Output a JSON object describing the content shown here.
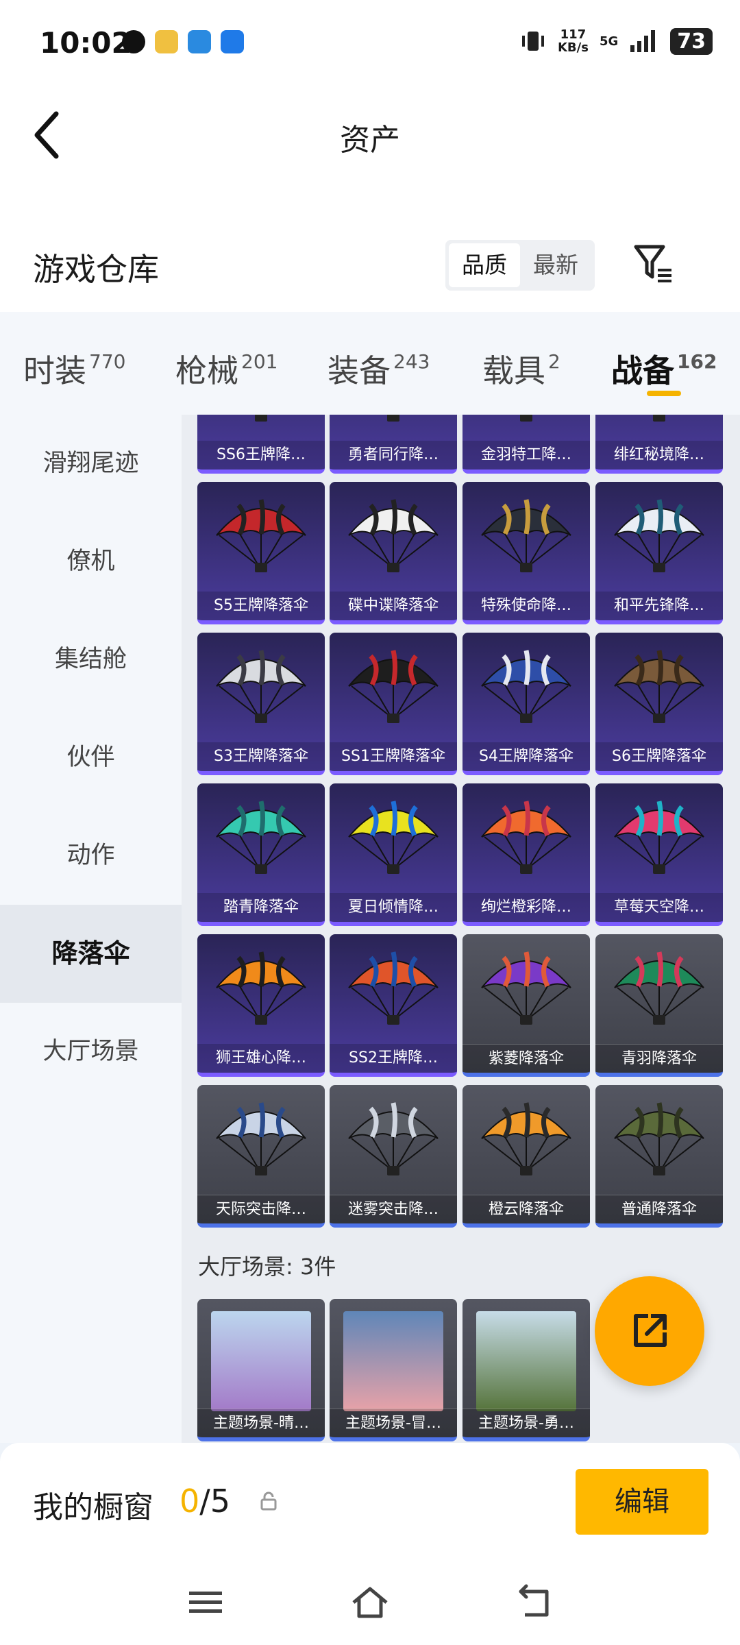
{
  "status_bar": {
    "time": "10:02",
    "net_speed_value": "117",
    "net_speed_unit": "KB/s",
    "network": "5G",
    "battery": "73"
  },
  "header": {
    "title": "资产"
  },
  "section": {
    "title": "游戏仓库",
    "sort_options": [
      "品质",
      "最新"
    ],
    "selected_sort": "品质"
  },
  "tabs": [
    {
      "label": "时装",
      "count": "770"
    },
    {
      "label": "枪械",
      "count": "201"
    },
    {
      "label": "装备",
      "count": "243"
    },
    {
      "label": "载具",
      "count": "2"
    },
    {
      "label": "战备",
      "count": "162"
    }
  ],
  "active_tab": "战备",
  "sidebar": {
    "items": [
      "滑翔尾迹",
      "僚机",
      "集结舱",
      "伙伴",
      "动作",
      "降落伞",
      "大厅场景"
    ],
    "active": "降落伞"
  },
  "parachutes": [
    {
      "name": "SS6王牌降…",
      "tier": "purple",
      "colors": [
        "#3a2f26",
        "#8a6a4a"
      ]
    },
    {
      "name": "勇者同行降…",
      "tier": "purple",
      "colors": [
        "#2b2b2b",
        "#6d6d6d"
      ]
    },
    {
      "name": "金羽特工降…",
      "tier": "purple",
      "colors": [
        "#4a3b22",
        "#c79a44"
      ]
    },
    {
      "name": "绯红秘境降…",
      "tier": "purple",
      "colors": [
        "#5a2b39",
        "#c06a7a"
      ]
    },
    {
      "name": "S5王牌降落伞",
      "tier": "purple",
      "colors": [
        "#c4272b",
        "#222222"
      ]
    },
    {
      "name": "碟中谍降落伞",
      "tier": "purple",
      "colors": [
        "#f0f0f0",
        "#222222"
      ]
    },
    {
      "name": "特殊使命降…",
      "tier": "purple",
      "colors": [
        "#2a2f3a",
        "#c89d3e"
      ]
    },
    {
      "name": "和平先锋降…",
      "tier": "purple",
      "colors": [
        "#e9eef5",
        "#1f5d77"
      ]
    },
    {
      "name": "S3王牌降落伞",
      "tier": "purple",
      "colors": [
        "#d9dbe0",
        "#3b3b45"
      ]
    },
    {
      "name": "SS1王牌降落伞",
      "tier": "purple",
      "colors": [
        "#1e1e1e",
        "#c6282c"
      ]
    },
    {
      "name": "S4王牌降落伞",
      "tier": "purple",
      "colors": [
        "#2e4ea8",
        "#e6e8f0"
      ]
    },
    {
      "name": "S6王牌降落伞",
      "tier": "purple",
      "colors": [
        "#7a5a3a",
        "#3a2a1a"
      ]
    },
    {
      "name": "踏青降落伞",
      "tier": "purple",
      "colors": [
        "#35c9b0",
        "#1f6d6d"
      ]
    },
    {
      "name": "夏日倾情降…",
      "tier": "purple",
      "colors": [
        "#e8e21f",
        "#1e6fd8"
      ]
    },
    {
      "name": "绚烂橙彩降…",
      "tier": "purple",
      "colors": [
        "#f06a2e",
        "#c8364a"
      ]
    },
    {
      "name": "草莓天空降…",
      "tier": "purple",
      "colors": [
        "#e23a6e",
        "#1fb3c8"
      ]
    },
    {
      "name": "狮王雄心降…",
      "tier": "purple",
      "colors": [
        "#f08a1a",
        "#1e1e1e"
      ]
    },
    {
      "name": "SS2王牌降…",
      "tier": "purple",
      "colors": [
        "#e0552a",
        "#1e4fa8"
      ]
    },
    {
      "name": "紫菱降落伞",
      "tier": "gray",
      "colors": [
        "#7a3ac8",
        "#e05a3a"
      ]
    },
    {
      "name": "青羽降落伞",
      "tier": "gray",
      "colors": [
        "#1e8a5a",
        "#d43a5a"
      ]
    },
    {
      "name": "天际突击降…",
      "tier": "gray",
      "colors": [
        "#c9d4e6",
        "#2a4a8a"
      ]
    },
    {
      "name": "迷雾突击降…",
      "tier": "gray",
      "colors": [
        "#5a5e66",
        "#d0d6e0"
      ]
    },
    {
      "name": "橙云降落伞",
      "tier": "gray",
      "colors": [
        "#f09a2a",
        "#2a2a2a"
      ]
    },
    {
      "name": "普通降落伞",
      "tier": "gray",
      "colors": [
        "#5a6a3a",
        "#2e3420"
      ]
    }
  ],
  "lobby": {
    "heading": "大厅场景: 3件",
    "scenes": [
      {
        "name": "主题场景-晴…",
        "colors": [
          "#bcd6ee",
          "#a37ac8"
        ]
      },
      {
        "name": "主题场景-冒…",
        "colors": [
          "#5f86b8",
          "#e8a2a8"
        ]
      },
      {
        "name": "主题场景-勇…",
        "colors": [
          "#c7dce8",
          "#55733a"
        ]
      }
    ]
  },
  "showcase": {
    "title": "我的橱窗",
    "current": "0",
    "total": "/5",
    "edit_label": "编辑"
  }
}
